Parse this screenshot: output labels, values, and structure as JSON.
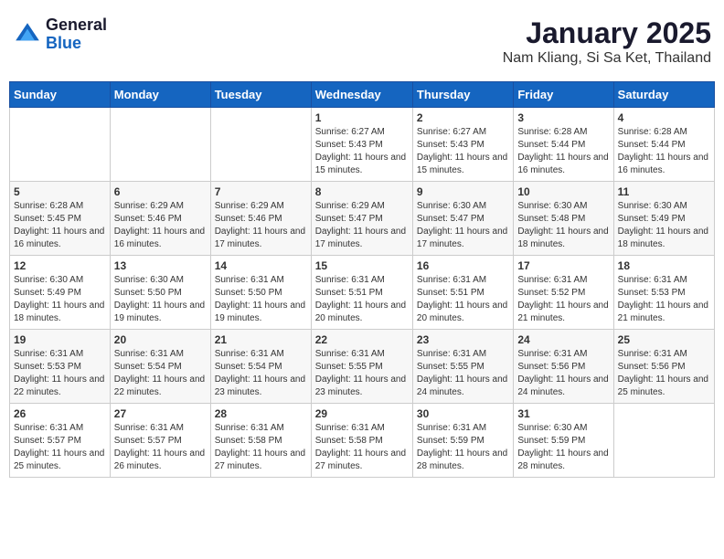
{
  "header": {
    "logo_general": "General",
    "logo_blue": "Blue",
    "month_year": "January 2025",
    "location": "Nam Kliang, Si Sa Ket, Thailand"
  },
  "weekdays": [
    "Sunday",
    "Monday",
    "Tuesday",
    "Wednesday",
    "Thursday",
    "Friday",
    "Saturday"
  ],
  "weeks": [
    [
      {
        "day": "",
        "sunrise": "",
        "sunset": "",
        "daylight": ""
      },
      {
        "day": "",
        "sunrise": "",
        "sunset": "",
        "daylight": ""
      },
      {
        "day": "",
        "sunrise": "",
        "sunset": "",
        "daylight": ""
      },
      {
        "day": "1",
        "sunrise": "Sunrise: 6:27 AM",
        "sunset": "Sunset: 5:43 PM",
        "daylight": "Daylight: 11 hours and 15 minutes."
      },
      {
        "day": "2",
        "sunrise": "Sunrise: 6:27 AM",
        "sunset": "Sunset: 5:43 PM",
        "daylight": "Daylight: 11 hours and 15 minutes."
      },
      {
        "day": "3",
        "sunrise": "Sunrise: 6:28 AM",
        "sunset": "Sunset: 5:44 PM",
        "daylight": "Daylight: 11 hours and 16 minutes."
      },
      {
        "day": "4",
        "sunrise": "Sunrise: 6:28 AM",
        "sunset": "Sunset: 5:44 PM",
        "daylight": "Daylight: 11 hours and 16 minutes."
      }
    ],
    [
      {
        "day": "5",
        "sunrise": "Sunrise: 6:28 AM",
        "sunset": "Sunset: 5:45 PM",
        "daylight": "Daylight: 11 hours and 16 minutes."
      },
      {
        "day": "6",
        "sunrise": "Sunrise: 6:29 AM",
        "sunset": "Sunset: 5:46 PM",
        "daylight": "Daylight: 11 hours and 16 minutes."
      },
      {
        "day": "7",
        "sunrise": "Sunrise: 6:29 AM",
        "sunset": "Sunset: 5:46 PM",
        "daylight": "Daylight: 11 hours and 17 minutes."
      },
      {
        "day": "8",
        "sunrise": "Sunrise: 6:29 AM",
        "sunset": "Sunset: 5:47 PM",
        "daylight": "Daylight: 11 hours and 17 minutes."
      },
      {
        "day": "9",
        "sunrise": "Sunrise: 6:30 AM",
        "sunset": "Sunset: 5:47 PM",
        "daylight": "Daylight: 11 hours and 17 minutes."
      },
      {
        "day": "10",
        "sunrise": "Sunrise: 6:30 AM",
        "sunset": "Sunset: 5:48 PM",
        "daylight": "Daylight: 11 hours and 18 minutes."
      },
      {
        "day": "11",
        "sunrise": "Sunrise: 6:30 AM",
        "sunset": "Sunset: 5:49 PM",
        "daylight": "Daylight: 11 hours and 18 minutes."
      }
    ],
    [
      {
        "day": "12",
        "sunrise": "Sunrise: 6:30 AM",
        "sunset": "Sunset: 5:49 PM",
        "daylight": "Daylight: 11 hours and 18 minutes."
      },
      {
        "day": "13",
        "sunrise": "Sunrise: 6:30 AM",
        "sunset": "Sunset: 5:50 PM",
        "daylight": "Daylight: 11 hours and 19 minutes."
      },
      {
        "day": "14",
        "sunrise": "Sunrise: 6:31 AM",
        "sunset": "Sunset: 5:50 PM",
        "daylight": "Daylight: 11 hours and 19 minutes."
      },
      {
        "day": "15",
        "sunrise": "Sunrise: 6:31 AM",
        "sunset": "Sunset: 5:51 PM",
        "daylight": "Daylight: 11 hours and 20 minutes."
      },
      {
        "day": "16",
        "sunrise": "Sunrise: 6:31 AM",
        "sunset": "Sunset: 5:51 PM",
        "daylight": "Daylight: 11 hours and 20 minutes."
      },
      {
        "day": "17",
        "sunrise": "Sunrise: 6:31 AM",
        "sunset": "Sunset: 5:52 PM",
        "daylight": "Daylight: 11 hours and 21 minutes."
      },
      {
        "day": "18",
        "sunrise": "Sunrise: 6:31 AM",
        "sunset": "Sunset: 5:53 PM",
        "daylight": "Daylight: 11 hours and 21 minutes."
      }
    ],
    [
      {
        "day": "19",
        "sunrise": "Sunrise: 6:31 AM",
        "sunset": "Sunset: 5:53 PM",
        "daylight": "Daylight: 11 hours and 22 minutes."
      },
      {
        "day": "20",
        "sunrise": "Sunrise: 6:31 AM",
        "sunset": "Sunset: 5:54 PM",
        "daylight": "Daylight: 11 hours and 22 minutes."
      },
      {
        "day": "21",
        "sunrise": "Sunrise: 6:31 AM",
        "sunset": "Sunset: 5:54 PM",
        "daylight": "Daylight: 11 hours and 23 minutes."
      },
      {
        "day": "22",
        "sunrise": "Sunrise: 6:31 AM",
        "sunset": "Sunset: 5:55 PM",
        "daylight": "Daylight: 11 hours and 23 minutes."
      },
      {
        "day": "23",
        "sunrise": "Sunrise: 6:31 AM",
        "sunset": "Sunset: 5:55 PM",
        "daylight": "Daylight: 11 hours and 24 minutes."
      },
      {
        "day": "24",
        "sunrise": "Sunrise: 6:31 AM",
        "sunset": "Sunset: 5:56 PM",
        "daylight": "Daylight: 11 hours and 24 minutes."
      },
      {
        "day": "25",
        "sunrise": "Sunrise: 6:31 AM",
        "sunset": "Sunset: 5:56 PM",
        "daylight": "Daylight: 11 hours and 25 minutes."
      }
    ],
    [
      {
        "day": "26",
        "sunrise": "Sunrise: 6:31 AM",
        "sunset": "Sunset: 5:57 PM",
        "daylight": "Daylight: 11 hours and 25 minutes."
      },
      {
        "day": "27",
        "sunrise": "Sunrise: 6:31 AM",
        "sunset": "Sunset: 5:57 PM",
        "daylight": "Daylight: 11 hours and 26 minutes."
      },
      {
        "day": "28",
        "sunrise": "Sunrise: 6:31 AM",
        "sunset": "Sunset: 5:58 PM",
        "daylight": "Daylight: 11 hours and 27 minutes."
      },
      {
        "day": "29",
        "sunrise": "Sunrise: 6:31 AM",
        "sunset": "Sunset: 5:58 PM",
        "daylight": "Daylight: 11 hours and 27 minutes."
      },
      {
        "day": "30",
        "sunrise": "Sunrise: 6:31 AM",
        "sunset": "Sunset: 5:59 PM",
        "daylight": "Daylight: 11 hours and 28 minutes."
      },
      {
        "day": "31",
        "sunrise": "Sunrise: 6:30 AM",
        "sunset": "Sunset: 5:59 PM",
        "daylight": "Daylight: 11 hours and 28 minutes."
      },
      {
        "day": "",
        "sunrise": "",
        "sunset": "",
        "daylight": ""
      }
    ]
  ]
}
